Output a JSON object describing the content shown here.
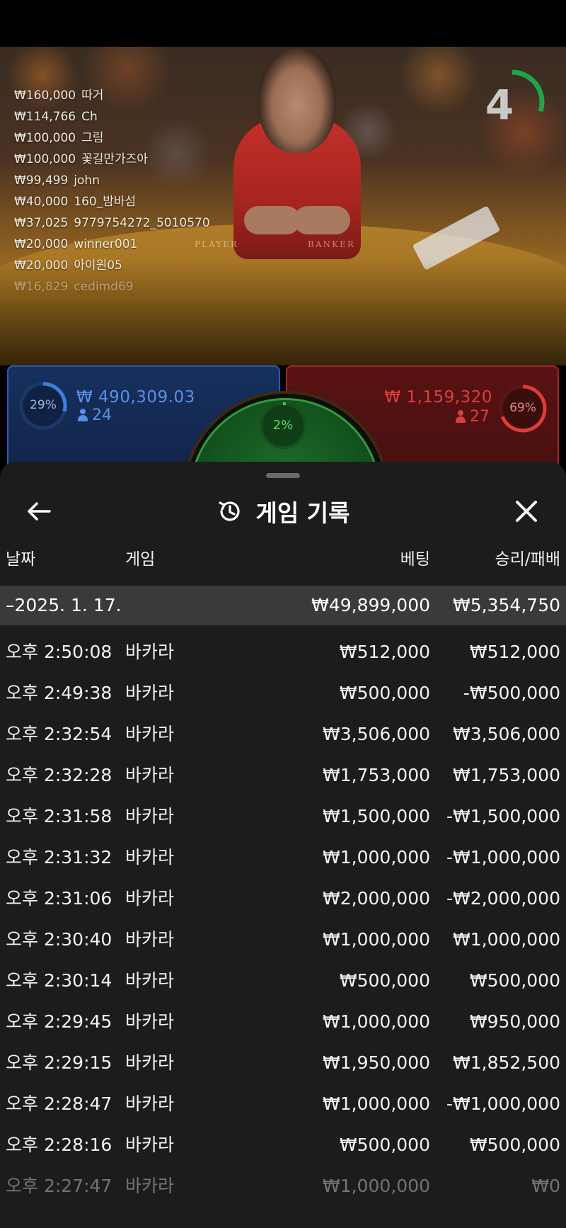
{
  "leaderboard": [
    {
      "amount": "₩160,000",
      "name": "따거"
    },
    {
      "amount": "₩114,766",
      "name": "Ch"
    },
    {
      "amount": "₩100,000",
      "name": "그림"
    },
    {
      "amount": "₩100,000",
      "name": "꽃길만가즈아"
    },
    {
      "amount": "₩99,499",
      "name": "john"
    },
    {
      "amount": "₩40,000",
      "name": "160_밤바섬"
    },
    {
      "amount": "₩37,025",
      "name": "9779754272_5010570"
    },
    {
      "amount": "₩20,000",
      "name": "winner001"
    },
    {
      "amount": "₩20,000",
      "name": "아이원05"
    },
    {
      "amount": "₩16,829",
      "name": "cedimd69"
    }
  ],
  "table_labels": {
    "player": "PLAYER",
    "banker": "BANKER"
  },
  "timer": {
    "value": "4",
    "progress": 0.3
  },
  "player": {
    "percent_label": "29%",
    "percent": 0.29,
    "stake": "₩ 490,309.03",
    "count": "24",
    "color": "#3f7fe0"
  },
  "banker": {
    "percent_label": "69%",
    "percent": 0.69,
    "stake": "₩ 1,159,320",
    "count": "27",
    "color": "#e03a3a"
  },
  "tie": {
    "percent_label": "2%",
    "percent": 0.02,
    "color": "#4fc95a"
  },
  "history": {
    "title": "게임 기록",
    "columns": {
      "date": "날짜",
      "game": "게임",
      "bet": "베팅",
      "win": "승리/패배"
    },
    "day": {
      "date": "–2025. 1. 17.",
      "bet": "₩49,899,000",
      "win": "₩5,354,750"
    },
    "rows": [
      {
        "time": "오후 2:50:08",
        "game": "바카라",
        "bet": "₩512,000",
        "win": "₩512,000"
      },
      {
        "time": "오후 2:49:38",
        "game": "바카라",
        "bet": "₩500,000",
        "win": "-₩500,000"
      },
      {
        "time": "오후 2:32:54",
        "game": "바카라",
        "bet": "₩3,506,000",
        "win": "₩3,506,000"
      },
      {
        "time": "오후 2:32:28",
        "game": "바카라",
        "bet": "₩1,753,000",
        "win": "₩1,753,000"
      },
      {
        "time": "오후 2:31:58",
        "game": "바카라",
        "bet": "₩1,500,000",
        "win": "-₩1,500,000"
      },
      {
        "time": "오후 2:31:32",
        "game": "바카라",
        "bet": "₩1,000,000",
        "win": "-₩1,000,000"
      },
      {
        "time": "오후 2:31:06",
        "game": "바카라",
        "bet": "₩2,000,000",
        "win": "-₩2,000,000"
      },
      {
        "time": "오후 2:30:40",
        "game": "바카라",
        "bet": "₩1,000,000",
        "win": "₩1,000,000"
      },
      {
        "time": "오후 2:30:14",
        "game": "바카라",
        "bet": "₩500,000",
        "win": "₩500,000"
      },
      {
        "time": "오후 2:29:45",
        "game": "바카라",
        "bet": "₩1,000,000",
        "win": "₩950,000"
      },
      {
        "time": "오후 2:29:15",
        "game": "바카라",
        "bet": "₩1,950,000",
        "win": "₩1,852,500"
      },
      {
        "time": "오후 2:28:47",
        "game": "바카라",
        "bet": "₩1,000,000",
        "win": "-₩1,000,000"
      },
      {
        "time": "오후 2:28:16",
        "game": "바카라",
        "bet": "₩500,000",
        "win": "₩500,000"
      },
      {
        "time": "오후 2:27:47",
        "game": "바카라",
        "bet": "₩1,000,000",
        "win": "₩0"
      }
    ]
  }
}
